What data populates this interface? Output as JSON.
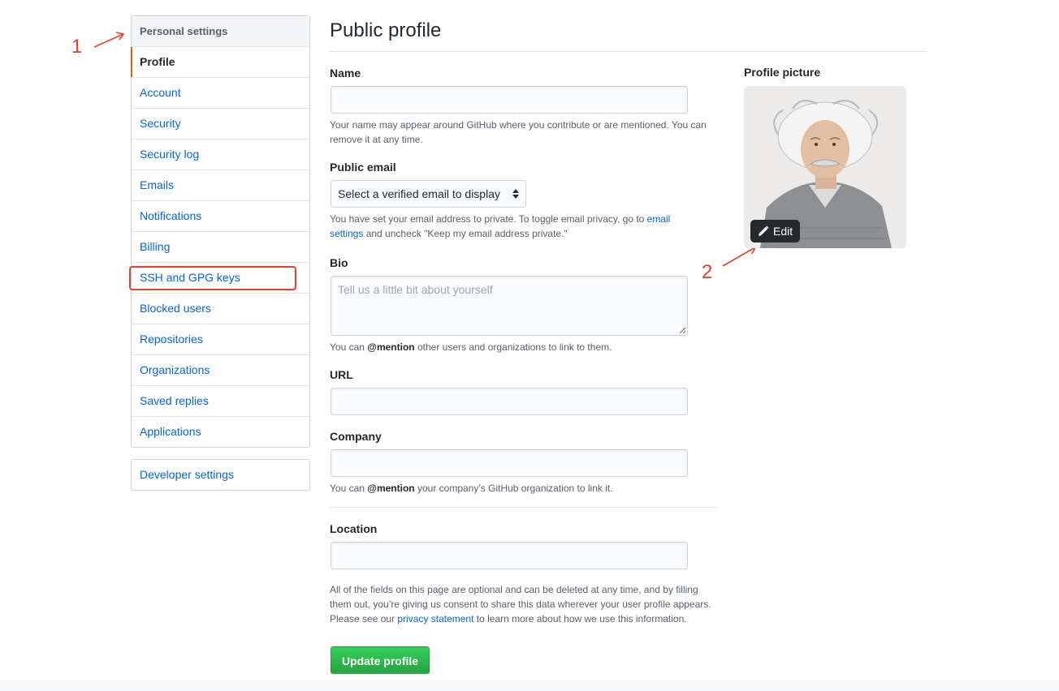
{
  "annotations": {
    "marker_1": "1",
    "marker_2": "2"
  },
  "sidebar": {
    "heading": "Personal settings",
    "items": [
      {
        "label": "Profile",
        "selected": true
      },
      {
        "label": "Account"
      },
      {
        "label": "Security"
      },
      {
        "label": "Security log"
      },
      {
        "label": "Emails"
      },
      {
        "label": "Notifications"
      },
      {
        "label": "Billing"
      },
      {
        "label": "SSH and GPG keys",
        "highlighted": true
      },
      {
        "label": "Blocked users"
      },
      {
        "label": "Repositories"
      },
      {
        "label": "Organizations"
      },
      {
        "label": "Saved replies"
      },
      {
        "label": "Applications"
      }
    ],
    "developer_settings": "Developer settings"
  },
  "main": {
    "title": "Public profile",
    "name": {
      "label": "Name",
      "value": "",
      "note": "Your name may appear around GitHub where you contribute or are mentioned. You can remove it at any time."
    },
    "public_email": {
      "label": "Public email",
      "selected": "Select a verified email to display",
      "note_before": "You have set your email address to private. To toggle email privacy, go to ",
      "note_link": "email settings",
      "note_after": " and uncheck \"Keep my email address private.\""
    },
    "bio": {
      "label": "Bio",
      "placeholder": "Tell us a little bit about yourself",
      "note_before": "You can ",
      "note_strong": "@mention",
      "note_after": " other users and organizations to link to them."
    },
    "url": {
      "label": "URL",
      "value": ""
    },
    "company": {
      "label": "Company",
      "value": "",
      "note_before": "You can ",
      "note_strong": "@mention",
      "note_after": " your company’s GitHub organization to link it."
    },
    "location": {
      "label": "Location",
      "value": ""
    },
    "consent_before": "All of the fields on this page are optional and can be deleted at any time, and by filling them out, you’re giving us consent to share this data wherever your user profile appears. Please see our ",
    "consent_link": "privacy statement",
    "consent_after": " to learn more about how we use this information.",
    "update_button": "Update profile"
  },
  "profile_picture": {
    "label": "Profile picture",
    "edit_label": "Edit"
  },
  "colors": {
    "link": "#0366d6",
    "annotation": "#e8402a",
    "button_green": "#28a745",
    "selected_bar": "#e36209"
  }
}
